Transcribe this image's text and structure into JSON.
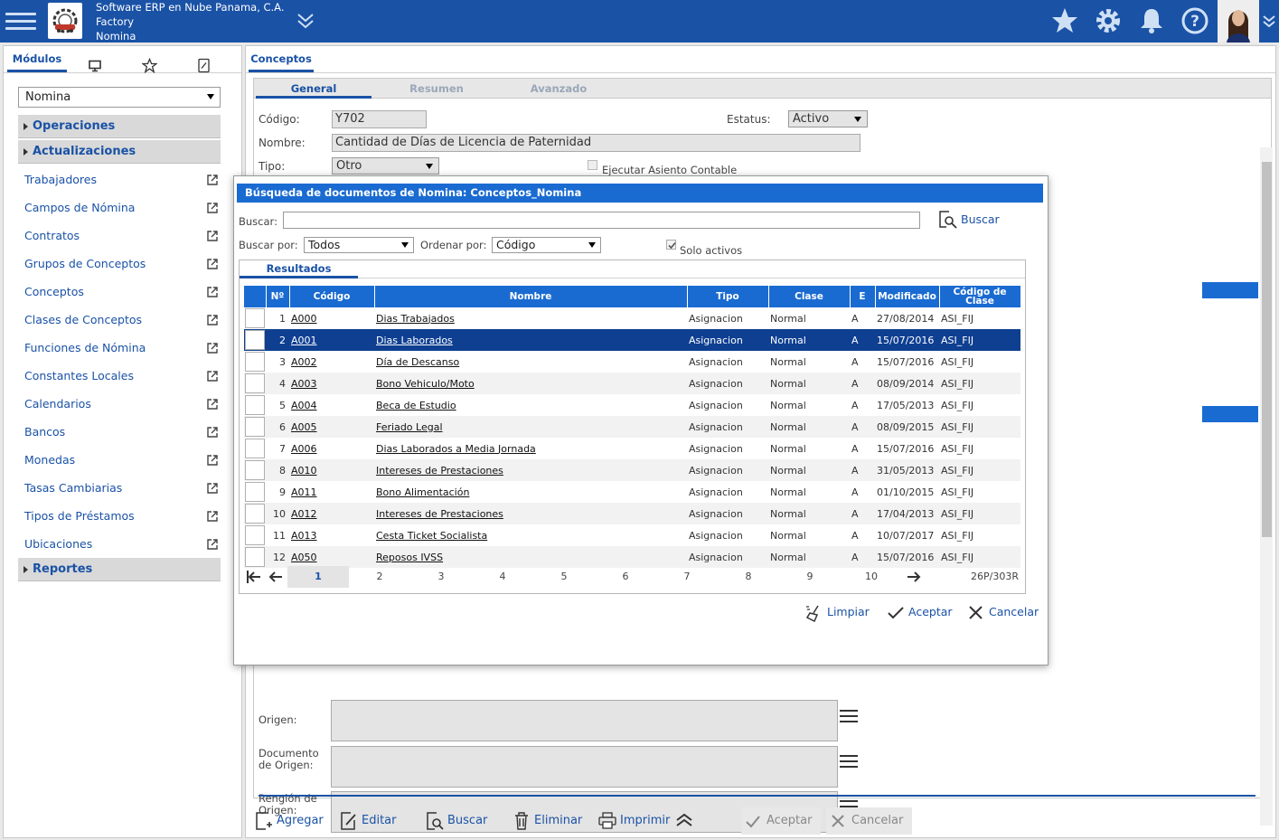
{
  "header": {
    "company_line1": "Software ERP en Nube Panama, C.A.",
    "company_line2": "Factory",
    "company_line3": "Nomina",
    "icons": [
      "menu-icon",
      "star-icon",
      "gear-icon",
      "bell-icon",
      "help-icon",
      "chevron-down-icon"
    ]
  },
  "sidebar": {
    "tab_label": "Módulos",
    "module_selected": "Nomina",
    "sections": [
      "Operaciones",
      "Actualizaciones",
      "Reportes"
    ],
    "items": [
      "Trabajadores",
      "Campos de Nómina",
      "Contratos",
      "Grupos de Conceptos",
      "Conceptos",
      "Clases de Conceptos",
      "Funciones de Nómina",
      "Constantes Locales",
      "Calendarios",
      "Bancos",
      "Monedas",
      "Tasas Cambiarias",
      "Tipos de Préstamos",
      "Ubicaciones"
    ]
  },
  "main": {
    "tab_label": "Conceptos",
    "subtabs": [
      "General",
      "Resumen",
      "Avanzado"
    ],
    "form": {
      "codigo_label": "Código:",
      "codigo_value": "Y702",
      "estatus_label": "Estatus:",
      "estatus_value": "Activo",
      "nombre_label": "Nombre:",
      "nombre_value": "Cantidad de Días de Licencia de Paternidad",
      "tipo_label": "Tipo:",
      "tipo_value": "Otro",
      "asiento_label": "Ejecutar Asiento Contable",
      "origen_label": "Origen:",
      "documento_origen_label_1": "Documento",
      "documento_origen_label_2": "de Origen:",
      "renglon_origen_label_1": "Renglón de",
      "renglon_origen_label_2": "Origen:"
    },
    "actions": {
      "agregar": "Agregar",
      "editar": "Editar",
      "buscar": "Buscar",
      "eliminar": "Eliminar",
      "imprimir": "Imprimir",
      "aceptar": "Aceptar",
      "cancelar": "Cancelar"
    }
  },
  "modal": {
    "title": "Búsqueda de documentos de Nomina: Conceptos_Nomina",
    "buscar_label": "Buscar:",
    "buscar_value": "",
    "buscar_button": "Buscar",
    "buscar_por_label": "Buscar por:",
    "buscar_por_value": "Todos",
    "ordenar_por_label": "Ordenar por:",
    "ordenar_por_value": "Código",
    "solo_activos_label": "Solo activos",
    "solo_activos_checked": true,
    "results_tab": "Resultados",
    "columns": [
      "Nº",
      "Código",
      "Nombre",
      "Tipo",
      "Clase",
      "E",
      "Modificado",
      "Código de Clase"
    ],
    "rows": [
      {
        "n": "1",
        "codigo": "A000",
        "nombre": "Dias Trabajados",
        "tipo": "Asignacion",
        "clase": "Normal",
        "e": "A",
        "modificado": "27/08/2014",
        "codigo_clase": "ASI_FIJ"
      },
      {
        "n": "2",
        "codigo": "A001",
        "nombre": "Dias Laborados",
        "tipo": "Asignacion",
        "clase": "Normal",
        "e": "A",
        "modificado": "15/07/2016",
        "codigo_clase": "ASI_FIJ"
      },
      {
        "n": "3",
        "codigo": "A002",
        "nombre": "Día de Descanso",
        "tipo": "Asignacion",
        "clase": "Normal",
        "e": "A",
        "modificado": "15/07/2016",
        "codigo_clase": "ASI_FIJ"
      },
      {
        "n": "4",
        "codigo": "A003",
        "nombre": "Bono Vehiculo/Moto",
        "tipo": "Asignacion",
        "clase": "Normal",
        "e": "A",
        "modificado": "08/09/2014",
        "codigo_clase": "ASI_FIJ"
      },
      {
        "n": "5",
        "codigo": "A004",
        "nombre": "Beca de Estudio",
        "tipo": "Asignacion",
        "clase": "Normal",
        "e": "A",
        "modificado": "17/05/2013",
        "codigo_clase": "ASI_FIJ"
      },
      {
        "n": "6",
        "codigo": "A005",
        "nombre": "Feriado Legal",
        "tipo": "Asignacion",
        "clase": "Normal",
        "e": "A",
        "modificado": "08/09/2015",
        "codigo_clase": "ASI_FIJ"
      },
      {
        "n": "7",
        "codigo": "A006",
        "nombre": "Dias Laborados a Media Jornada",
        "tipo": "Asignacion",
        "clase": "Normal",
        "e": "A",
        "modificado": "15/07/2016",
        "codigo_clase": "ASI_FIJ"
      },
      {
        "n": "8",
        "codigo": "A010",
        "nombre": "Intereses de Prestaciones",
        "tipo": "Asignacion",
        "clase": "Normal",
        "e": "A",
        "modificado": "31/05/2013",
        "codigo_clase": "ASI_FIJ"
      },
      {
        "n": "9",
        "codigo": "A011",
        "nombre": "Bono Alimentación",
        "tipo": "Asignacion",
        "clase": "Normal",
        "e": "A",
        "modificado": "01/10/2015",
        "codigo_clase": "ASI_FIJ"
      },
      {
        "n": "10",
        "codigo": "A012",
        "nombre": "Intereses de Prestaciones",
        "tipo": "Asignacion",
        "clase": "Normal",
        "e": "A",
        "modificado": "17/04/2013",
        "codigo_clase": "ASI_FIJ"
      },
      {
        "n": "11",
        "codigo": "A013",
        "nombre": "Cesta Ticket Socialista",
        "tipo": "Asignacion",
        "clase": "Normal",
        "e": "A",
        "modificado": "10/07/2017",
        "codigo_clase": "ASI_FIJ"
      },
      {
        "n": "12",
        "codigo": "A050",
        "nombre": "Reposos IVSS",
        "tipo": "Asignacion",
        "clase": "Normal",
        "e": "A",
        "modificado": "15/07/2016",
        "codigo_clase": "ASI_FIJ"
      }
    ],
    "selected_row": 2,
    "pager": {
      "pages": [
        "1",
        "2",
        "3",
        "4",
        "5",
        "6",
        "7",
        "8",
        "9",
        "10"
      ],
      "current": "1",
      "info": "26P/303R"
    },
    "buttons": {
      "limpiar": "Limpiar",
      "aceptar": "Aceptar",
      "cancelar": "Cancelar"
    }
  },
  "colors": {
    "brand": "#1a52a6",
    "header_blue": "#1a6bd1",
    "selected_row": "#0e3f91"
  }
}
